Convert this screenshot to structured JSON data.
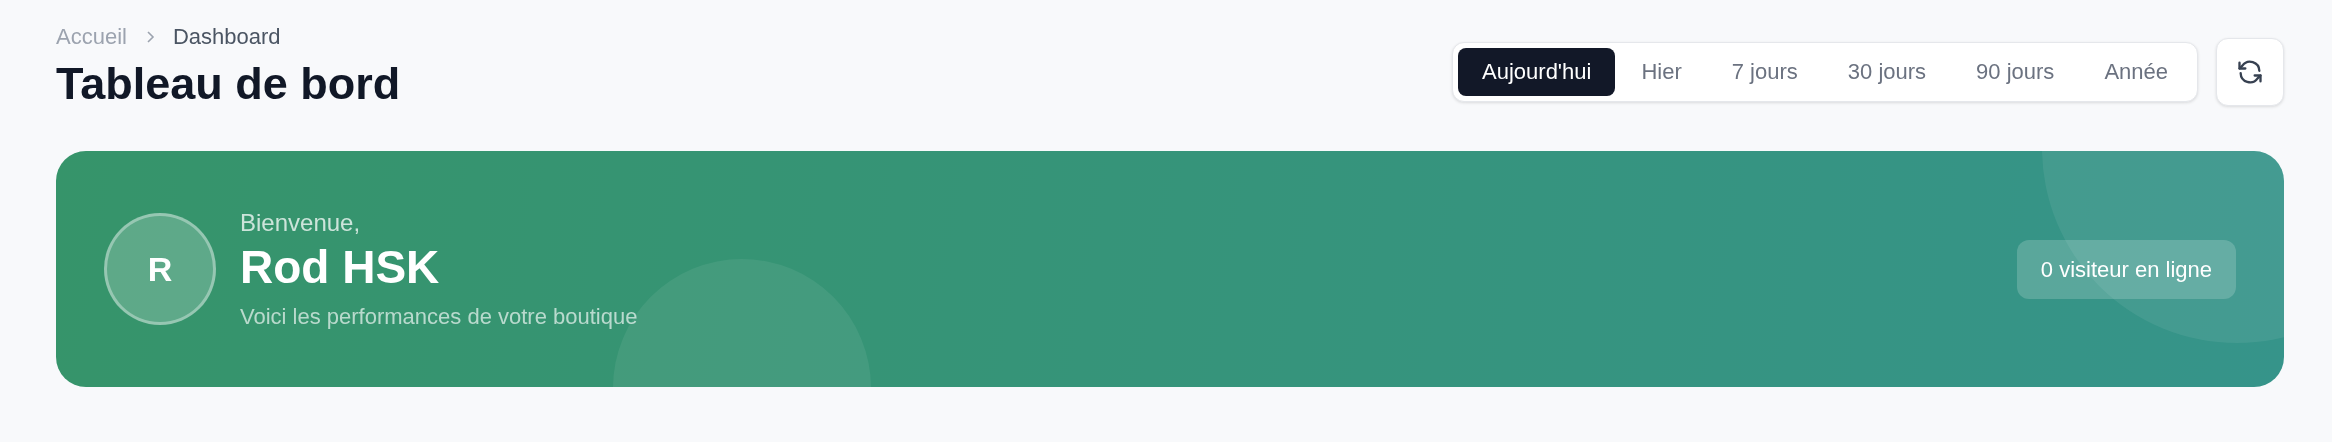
{
  "breadcrumb": [
    {
      "label": "Accueil",
      "current": false
    },
    {
      "label": "Dashboard",
      "current": true
    }
  ],
  "title": "Tableau de bord",
  "periods": [
    {
      "label": "Aujourd'hui",
      "selected": true
    },
    {
      "label": "Hier",
      "selected": false
    },
    {
      "label": "7 jours",
      "selected": false
    },
    {
      "label": "30 jours",
      "selected": false
    },
    {
      "label": "90 jours",
      "selected": false
    },
    {
      "label": "Année",
      "selected": false
    }
  ],
  "welcome": {
    "avatar": "R",
    "greeting": "Bienvenue,",
    "name": "Rod HSK",
    "subtitle": "Voici les performances de votre boutique",
    "visitors": "0 visiteur en ligne"
  }
}
